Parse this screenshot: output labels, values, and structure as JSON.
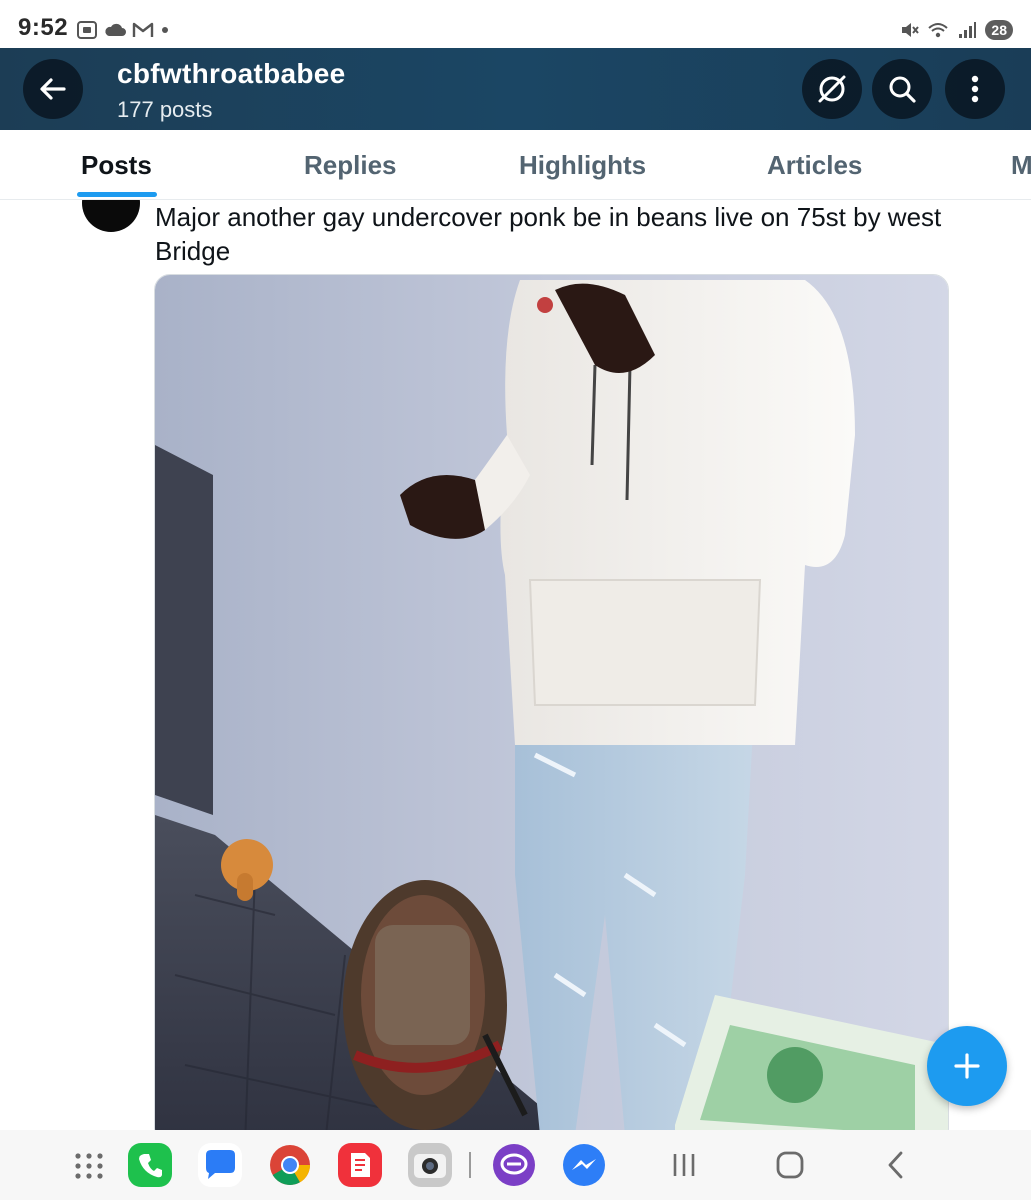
{
  "status_bar": {
    "time": "9:52",
    "battery": "28",
    "icons": [
      "screenshot-icon",
      "cloud-icon",
      "gmail-icon",
      "dot-icon",
      "mute-icon",
      "wifi-icon",
      "signal-icon"
    ]
  },
  "header": {
    "title": "cbfwthroatbabee",
    "subtitle": "177 posts",
    "colors": {
      "background": "#1b4664",
      "button_bg": "#0b1620"
    }
  },
  "tabs": [
    {
      "label": "Posts",
      "active": true
    },
    {
      "label": "Replies",
      "active": false
    },
    {
      "label": "Highlights",
      "active": false
    },
    {
      "label": "Articles",
      "active": false
    },
    {
      "label": "M",
      "active": false
    }
  ],
  "post": {
    "text": "Major another gay undercover ponk be in beans live on 75st by west Bridge"
  },
  "fab": {
    "icon": "plus-icon",
    "color": "#1d9bf0"
  },
  "nav": {
    "apps": [
      "app-drawer-icon",
      "phone-icon",
      "messages-icon",
      "chrome-icon",
      "notes-icon",
      "camera-icon",
      "chat-icon",
      "messenger-icon"
    ],
    "system": [
      "recents-icon",
      "home-icon",
      "back-icon"
    ]
  }
}
